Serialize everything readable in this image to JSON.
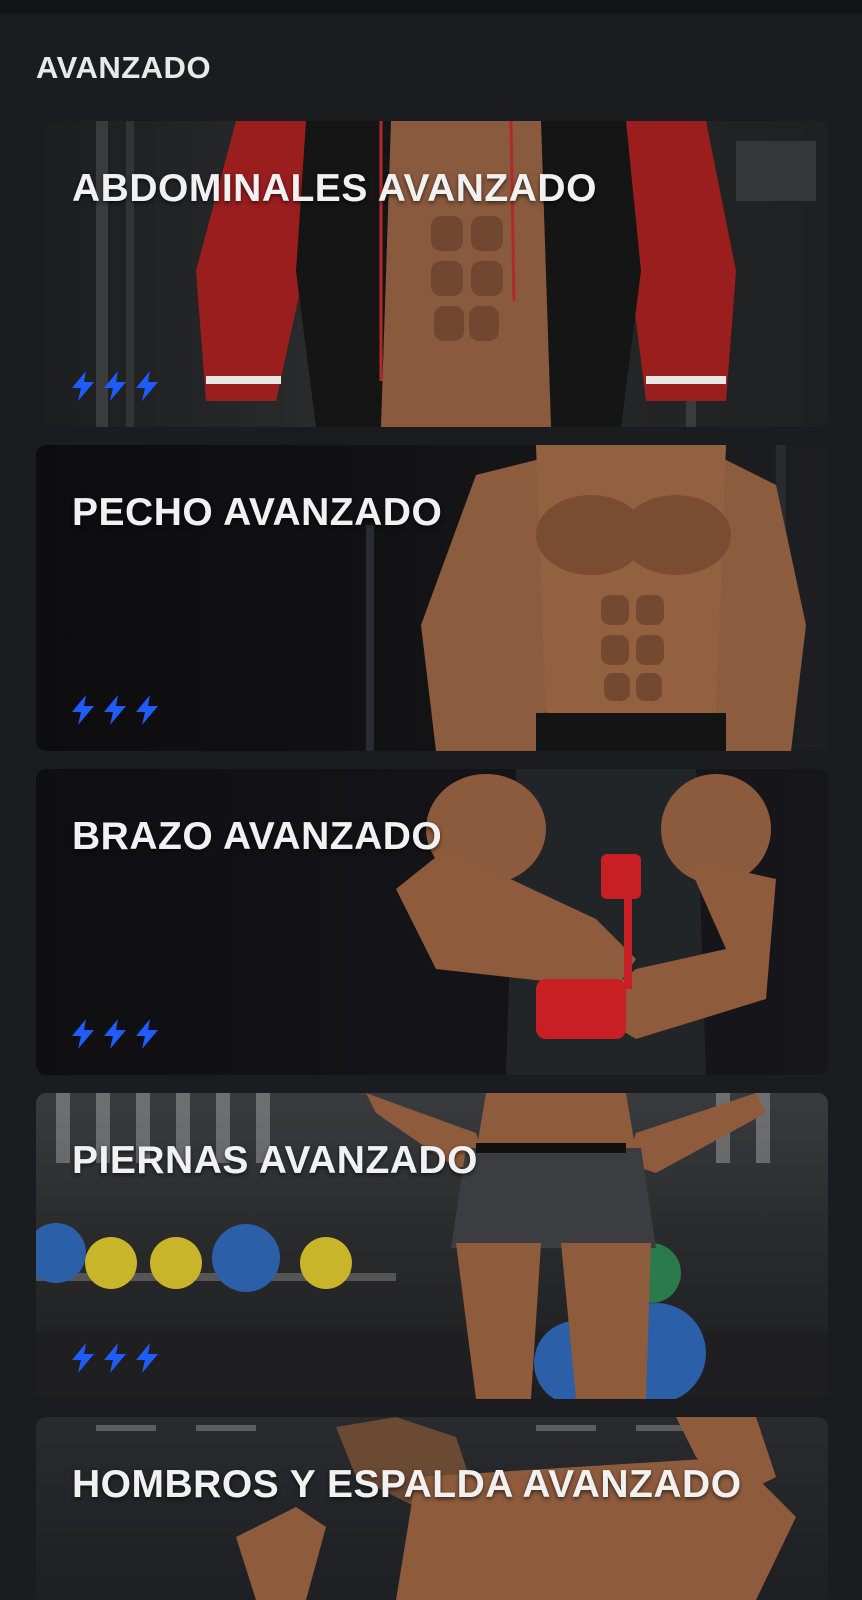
{
  "section": {
    "title": "AVANZADO"
  },
  "cards": [
    {
      "title": "ABDOMINALES AVANZADO",
      "level_icons": [
        "bolt-icon",
        "bolt-icon",
        "bolt-icon"
      ]
    },
    {
      "title": "PECHO AVANZADO",
      "level_icons": [
        "bolt-icon",
        "bolt-icon",
        "bolt-icon"
      ]
    },
    {
      "title": "BRAZO AVANZADO",
      "level_icons": [
        "bolt-icon",
        "bolt-icon",
        "bolt-icon"
      ]
    },
    {
      "title": "PIERNAS AVANZADO",
      "level_icons": [
        "bolt-icon",
        "bolt-icon",
        "bolt-icon"
      ]
    },
    {
      "title": "HOMBROS Y ESPALDA AVANZADO",
      "level_icons": []
    }
  ],
  "colors": {
    "background": "#1b1c1f",
    "bolt": "#1f5cff",
    "title_text": "#f1f1f1"
  }
}
